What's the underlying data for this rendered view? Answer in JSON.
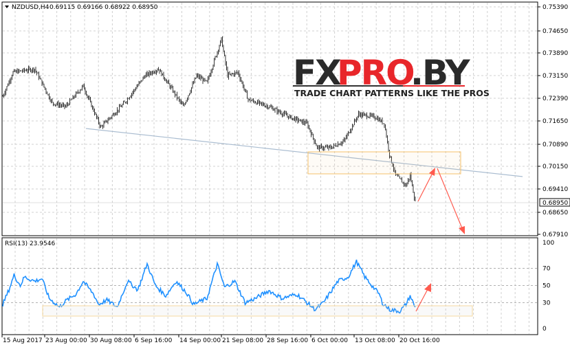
{
  "header": {
    "symbol_label": "NZDUSD,H4",
    "ohlc": "0.69115 0.69166 0.68922 0.68950"
  },
  "logo": {
    "part1": "FX",
    "part2": "PRO",
    "part3": ".BY",
    "tagline": "TRADE CHART PATTERNS LIKE THE PROS"
  },
  "price_axis": {
    "ticks": [
      "0.75390",
      "0.74650",
      "0.73890",
      "0.73150",
      "0.72390",
      "0.71650",
      "0.70890",
      "0.70150",
      "0.69410",
      "0.68650",
      "0.67910"
    ],
    "current_price": "0.68950"
  },
  "rsi": {
    "label": "RSI(13) 23.9546",
    "ticks": [
      "100",
      "70",
      "50",
      "30",
      "0"
    ]
  },
  "time_axis": {
    "labels": [
      "15 Aug 2017",
      "23 Aug 00:00",
      "30 Aug 08:00",
      "6 Sep 16:00",
      "14 Sep 00:00",
      "21 Sep 08:00",
      "28 Sep 16:00",
      "6 Oct 00:00",
      "13 Oct 08:00",
      "20 Oct 16:00"
    ]
  },
  "colors": {
    "candle": "#000000",
    "rsi_line": "#1e90ff",
    "trendline": "#a9bcd0",
    "zone": "#f5c26b",
    "arrow": "#ff5a4e",
    "grid": "#c8c8c8"
  },
  "chart_data": {
    "type": "line",
    "price_range": [
      0.6791,
      0.7539
    ],
    "price_path": [
      [
        0,
        0.7245
      ],
      [
        10,
        0.7324
      ],
      [
        31,
        0.7335
      ],
      [
        48,
        0.7223
      ],
      [
        61,
        0.7211
      ],
      [
        78,
        0.7279
      ],
      [
        95,
        0.7143
      ],
      [
        118,
        0.7223
      ],
      [
        138,
        0.7313
      ],
      [
        151,
        0.7335
      ],
      [
        175,
        0.7211
      ],
      [
        188,
        0.7313
      ],
      [
        198,
        0.729
      ],
      [
        208,
        0.7392
      ],
      [
        212,
        0.7433
      ],
      [
        218,
        0.7313
      ],
      [
        228,
        0.7324
      ],
      [
        238,
        0.7234
      ],
      [
        258,
        0.7211
      ],
      [
        278,
        0.7177
      ],
      [
        295,
        0.7155
      ],
      [
        305,
        0.7076
      ],
      [
        318,
        0.7076
      ],
      [
        331,
        0.7098
      ],
      [
        345,
        0.7186
      ],
      [
        361,
        0.7177
      ],
      [
        370,
        0.7155
      ],
      [
        375,
        0.7053
      ],
      [
        381,
        0.6985
      ],
      [
        391,
        0.6951
      ],
      [
        395,
        0.6985
      ],
      [
        400,
        0.6896
      ]
    ],
    "rsi_range": [
      0,
      100
    ],
    "rsi_path": [
      [
        0,
        28
      ],
      [
        6,
        45
      ],
      [
        11,
        62
      ],
      [
        17,
        50
      ],
      [
        21,
        60
      ],
      [
        31,
        55
      ],
      [
        38,
        58
      ],
      [
        45,
        35
      ],
      [
        55,
        25
      ],
      [
        61,
        32
      ],
      [
        71,
        40
      ],
      [
        78,
        55
      ],
      [
        88,
        40
      ],
      [
        93,
        28
      ],
      [
        101,
        33
      ],
      [
        111,
        25
      ],
      [
        121,
        55
      ],
      [
        131,
        45
      ],
      [
        140,
        75
      ],
      [
        148,
        50
      ],
      [
        158,
        38
      ],
      [
        168,
        55
      ],
      [
        178,
        42
      ],
      [
        185,
        28
      ],
      [
        198,
        35
      ],
      [
        208,
        75
      ],
      [
        215,
        48
      ],
      [
        225,
        55
      ],
      [
        235,
        30
      ],
      [
        245,
        35
      ],
      [
        258,
        44
      ],
      [
        271,
        35
      ],
      [
        285,
        40
      ],
      [
        295,
        30
      ],
      [
        303,
        22
      ],
      [
        311,
        30
      ],
      [
        325,
        55
      ],
      [
        335,
        60
      ],
      [
        343,
        78
      ],
      [
        351,
        60
      ],
      [
        358,
        50
      ],
      [
        365,
        40
      ],
      [
        368,
        30
      ],
      [
        375,
        22
      ],
      [
        385,
        20
      ],
      [
        391,
        28
      ],
      [
        395,
        38
      ],
      [
        400,
        24
      ]
    ],
    "rsi_levels": [
      70,
      50,
      30
    ]
  }
}
